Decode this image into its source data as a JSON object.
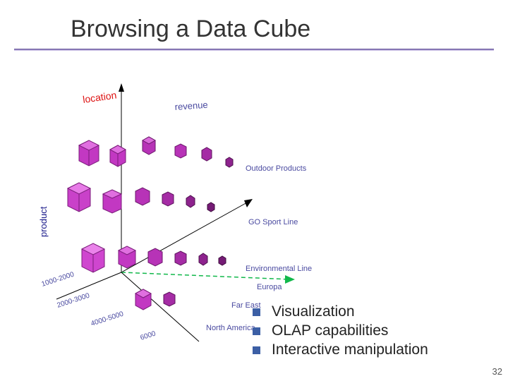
{
  "title": "Browsing a Data Cube",
  "figure": {
    "axes": {
      "location": "location",
      "revenue": "revenue",
      "product": "product"
    },
    "product_categories": [
      "Outdoor Products",
      "GO Sport Line",
      "Environmental Line"
    ],
    "locations": [
      "Europa",
      "Far East",
      "North America"
    ],
    "revenue_ticks": [
      "1000-2000",
      "2000-3000",
      "4000-5000",
      "6000"
    ]
  },
  "bullets": [
    "Visualization",
    "OLAP capabilities",
    "Interactive manipulation"
  ],
  "page_number": "32"
}
